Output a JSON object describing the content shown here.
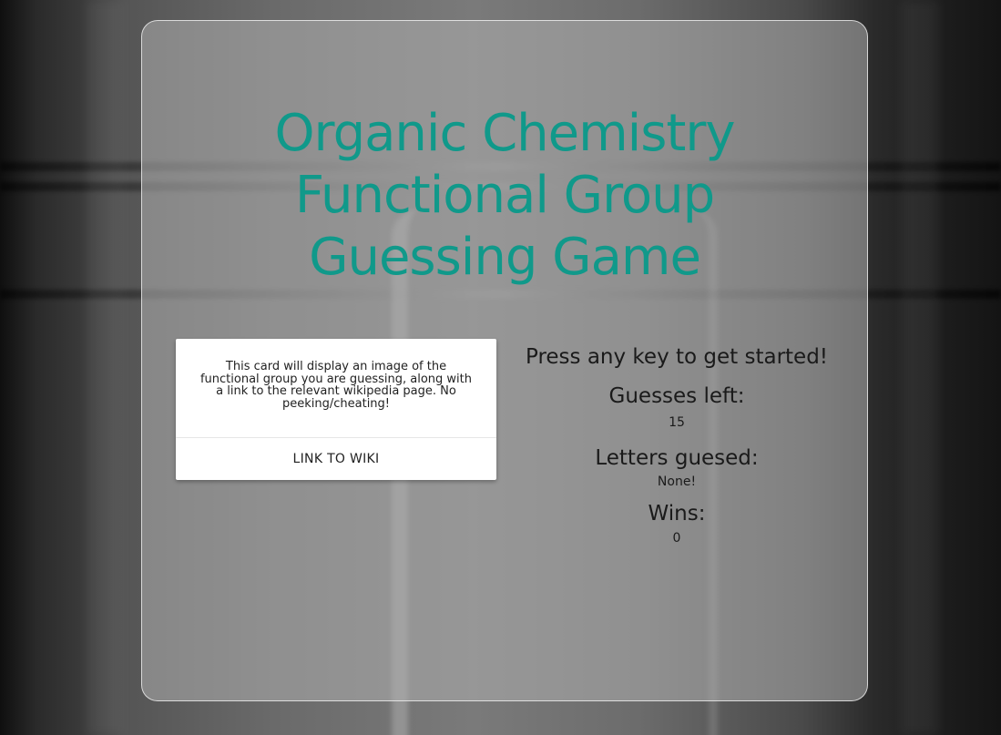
{
  "header": {
    "title_lines": [
      "Organic Chemistry",
      "Functional Group",
      "Guessing Game"
    ]
  },
  "card": {
    "description": "This card will display an image of the functional group you are guessing, along with a link to the relevant wikipedia page. No peeking/cheating!",
    "link_label": "LINK TO WIKI"
  },
  "game": {
    "prompt": "Press any key to get started!",
    "guesses_left_label": "Guesses left:",
    "guesses_left_value": "15",
    "letters_guessed_label": "Letters guesed:",
    "letters_guessed_value": "None!",
    "wins_label": "Wins:",
    "wins_value": "0"
  },
  "colors": {
    "title": "#10998a",
    "card_background": "#ffffff",
    "panel_background": "rgba(175,175,175,0.55)"
  }
}
